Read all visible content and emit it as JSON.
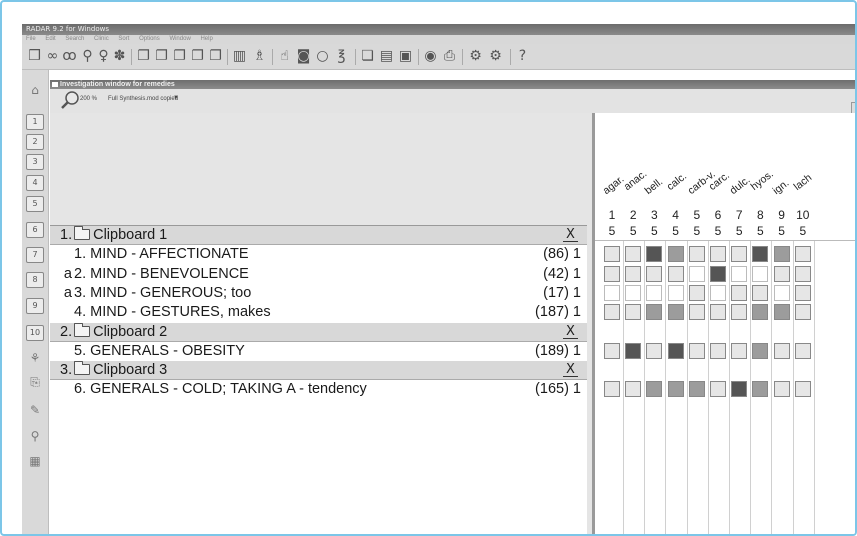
{
  "app": {
    "title": "RADAR 9.2 for Windows",
    "menu": [
      "File",
      "Edit",
      "Search",
      "Clinic",
      "Sort",
      "Options",
      "Window",
      "Help"
    ]
  },
  "toolbar_icons": [
    "new-icon",
    "binoculars-icon",
    "glasses-icon",
    "search-icon",
    "bulb-icon",
    "settings-icon",
    "clipboard-1-icon",
    "clipboard-2-icon",
    "clipboard-3-icon",
    "clipboard-4-icon",
    "clipboard-5-icon",
    "chart-icon",
    "figures-icon",
    "hand-icon",
    "eye-icon",
    "circle-icon",
    "rotate-icon",
    "doc-icon",
    "doc-2-icon",
    "doc-3-icon",
    "globe-icon",
    "printer-icon",
    "tools-icon",
    "tools-2-icon",
    "help-icon"
  ],
  "left_tools": [
    "1",
    "2",
    "3",
    "4",
    "5",
    "6",
    "7",
    "8",
    "9",
    "10"
  ],
  "window": {
    "title": "Investigation window for remedies",
    "zoom": "200 %",
    "mode": "Full Synthesis.mod copied"
  },
  "clipboards": [
    {
      "label": "1.",
      "name": "Clipboard 1",
      "close": "X",
      "rubrics": [
        {
          "prefix": "",
          "num": "1.",
          "text": "MIND - AFFECTIONATE",
          "count": "(86) 1",
          "cells": [
            1,
            1,
            3,
            2,
            1,
            1,
            1,
            3,
            2,
            1
          ]
        },
        {
          "prefix": "a",
          "num": "2.",
          "text": "MIND - BENEVOLENCE",
          "count": "(42) 1",
          "cells": [
            1,
            1,
            1,
            1,
            0,
            3,
            0,
            0,
            1,
            1
          ]
        },
        {
          "prefix": "a",
          "num": "3.",
          "text": "MIND - GENEROUS; too",
          "count": "(17) 1",
          "cells": [
            0,
            0,
            0,
            0,
            1,
            0,
            1,
            1,
            0,
            1
          ]
        },
        {
          "prefix": "",
          "num": "4.",
          "text": "MIND - GESTURES, makes",
          "count": "(187) 1",
          "cells": [
            1,
            1,
            2,
            2,
            1,
            1,
            1,
            2,
            2,
            1
          ]
        }
      ]
    },
    {
      "label": "2.",
      "name": "Clipboard 2",
      "close": "X",
      "rubrics": [
        {
          "prefix": "",
          "num": "5.",
          "text": "GENERALS - OBESITY",
          "count": "(189) 1",
          "cells": [
            1,
            3,
            1,
            3,
            1,
            1,
            1,
            2,
            1,
            1
          ]
        }
      ]
    },
    {
      "label": "3.",
      "name": "Clipboard 3",
      "close": "X",
      "rubrics": [
        {
          "prefix": "",
          "num": "6.",
          "text": "GENERALS - COLD; TAKING A - tendency",
          "count": "(165) 1",
          "cells": [
            1,
            1,
            2,
            2,
            2,
            1,
            3,
            2,
            1,
            1
          ]
        }
      ]
    }
  ],
  "remedies": [
    {
      "name": "agar.",
      "num": "1",
      "degree": "5"
    },
    {
      "name": "anac.",
      "num": "2",
      "degree": "5"
    },
    {
      "name": "bell.",
      "num": "3",
      "degree": "5"
    },
    {
      "name": "calc.",
      "num": "4",
      "degree": "5"
    },
    {
      "name": "carb-v.",
      "num": "5",
      "degree": "5"
    },
    {
      "name": "carc.",
      "num": "6",
      "degree": "5"
    },
    {
      "name": "dulc.",
      "num": "7",
      "degree": "5"
    },
    {
      "name": "hyos.",
      "num": "8",
      "degree": "5"
    },
    {
      "name": "ign.",
      "num": "9",
      "degree": "5"
    },
    {
      "name": "lach",
      "num": "10",
      "degree": "5"
    }
  ],
  "colors": {
    "cell_none": "#ffffff",
    "cell_1": "#e6e6e6",
    "cell_2": "#9c9c9c",
    "cell_3": "#555555",
    "accent_border": "#7cc6e8"
  }
}
